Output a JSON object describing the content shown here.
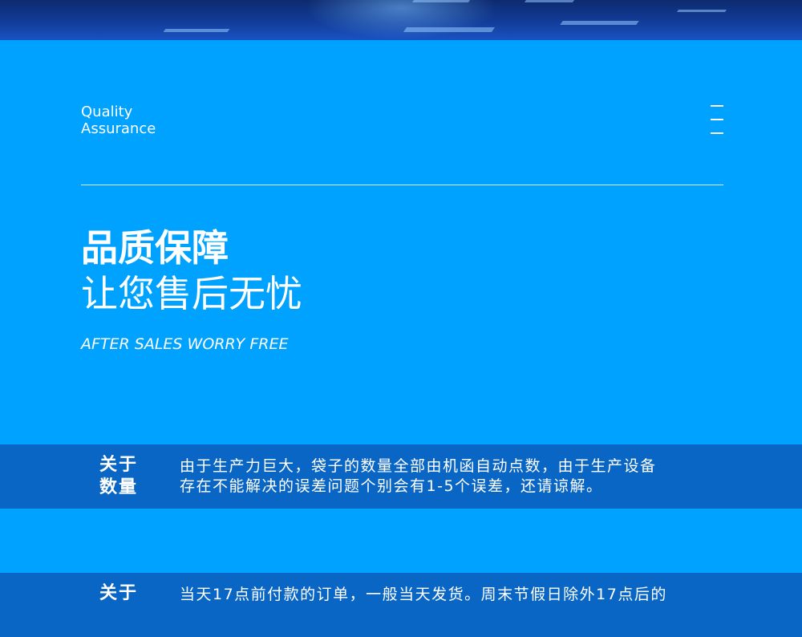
{
  "header": {
    "label_line1": "Quality",
    "label_line2": "Assurance",
    "menu_icon": "hamburger-menu-icon"
  },
  "hero": {
    "title": "品质保障",
    "subtitle": "让您售后无忧",
    "tagline": "AFTER SALES WORRY FREE"
  },
  "info_blocks": [
    {
      "label_line1": "关于",
      "label_line2": "数量",
      "text_line1": "由于生产力巨大，袋子的数量全部由机函自动点数，由于生产设备",
      "text_line2": "存在不能解决的误差问题个别会有1-5个误差，还请谅解。"
    },
    {
      "label_line1": "关于",
      "text_line1": "当天17点前付款的订单，一般当天发货。周末节假日除外17点后的"
    }
  ],
  "colors": {
    "background": "#00a2ff",
    "band": "#0a66c4",
    "banner": "#123d99",
    "text": "#ffffff"
  }
}
